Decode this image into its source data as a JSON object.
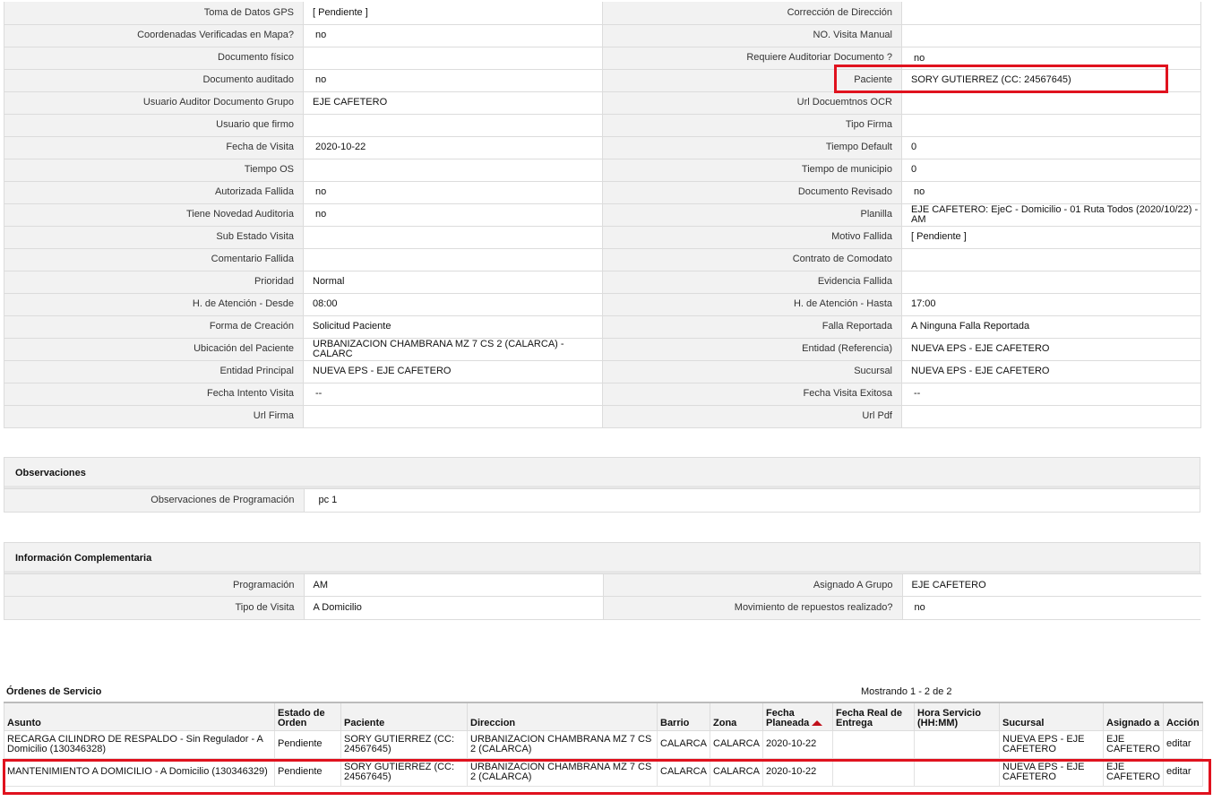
{
  "detail": {
    "rows": [
      [
        {
          "label": "Toma de Datos GPS",
          "value": "[ Pendiente ]"
        },
        {
          "label": "Corrección de Dirección",
          "value": ""
        }
      ],
      [
        {
          "label": "Coordenadas Verificadas en Mapa?",
          "value": "no"
        },
        {
          "label": "NO. Visita Manual",
          "value": ""
        }
      ],
      [
        {
          "label": "Documento físico",
          "value": ""
        },
        {
          "label": "Requiere Auditoriar Documento ?",
          "value": "no"
        }
      ],
      [
        {
          "label": "Documento auditado",
          "value": "no"
        },
        {
          "label": "Paciente",
          "value": "SORY GUTIERREZ (CC: 24567645)"
        }
      ],
      [
        {
          "label": "Usuario Auditor Documento Grupo",
          "value": "EJE CAFETERO"
        },
        {
          "label": "Url Docuemtnos OCR",
          "value": ""
        }
      ],
      [
        {
          "label": "Usuario que firmo",
          "value": ""
        },
        {
          "label": "Tipo Firma",
          "value": ""
        }
      ],
      [
        {
          "label": "Fecha de Visita",
          "value": "2020-10-22"
        },
        {
          "label": "Tiempo Default",
          "value": "0"
        }
      ],
      [
        {
          "label": "Tiempo OS",
          "value": ""
        },
        {
          "label": "Tiempo de municipio",
          "value": "0"
        }
      ],
      [
        {
          "label": "Autorizada Fallida",
          "value": "no"
        },
        {
          "label": "Documento Revisado",
          "value": "no"
        }
      ],
      [
        {
          "label": "Tiene Novedad Auditoria",
          "value": "no"
        },
        {
          "label": "Planilla",
          "value": "EJE CAFETERO: EjeC - Domicilio - 01 Ruta Todos (2020/10/22) - AM"
        }
      ],
      [
        {
          "label": "Sub Estado Visita",
          "value": ""
        },
        {
          "label": "Motivo Fallida",
          "value": "[ Pendiente ]"
        }
      ],
      [
        {
          "label": "Comentario Fallida",
          "value": ""
        },
        {
          "label": "Contrato de Comodato",
          "value": ""
        }
      ],
      [
        {
          "label": "Prioridad",
          "value": "Normal"
        },
        {
          "label": "Evidencia Fallida",
          "value": ""
        }
      ],
      [
        {
          "label": "H. de Atención - Desde",
          "value": "08:00"
        },
        {
          "label": "H. de Atención - Hasta",
          "value": "17:00"
        }
      ],
      [
        {
          "label": "Forma de Creación",
          "value": "Solicitud Paciente"
        },
        {
          "label": "Falla Reportada",
          "value": "A Ninguna Falla Reportada"
        }
      ],
      [
        {
          "label": "Ubicación del Paciente",
          "value": "URBANIZACION CHAMBRANA MZ 7 CS 2 (CALARCA) - CALARC"
        },
        {
          "label": "Entidad (Referencia)",
          "value": "NUEVA EPS - EJE CAFETERO"
        }
      ],
      [
        {
          "label": "Entidad Principal",
          "value": "NUEVA EPS - EJE CAFETERO"
        },
        {
          "label": "Sucursal",
          "value": "NUEVA EPS - EJE CAFETERO"
        }
      ],
      [
        {
          "label": "Fecha Intento Visita",
          "value": "--"
        },
        {
          "label": "Fecha Visita Exitosa",
          "value": "--"
        }
      ],
      [
        {
          "label": "Url Firma",
          "value": ""
        },
        {
          "label": "Url Pdf",
          "value": ""
        }
      ]
    ]
  },
  "observaciones": {
    "title": "Observaciones",
    "label": "Observaciones de Programación",
    "value": "pc 1"
  },
  "info_complementaria": {
    "title": "Información Complementaria",
    "rows": [
      [
        {
          "label": "Programación",
          "value": "AM"
        },
        {
          "label": "Asignado A Grupo",
          "value": "EJE CAFETERO"
        }
      ],
      [
        {
          "label": "Tipo de Visita",
          "value": "A Domicilio"
        },
        {
          "label": "Movimiento de repuestos realizado?",
          "value": "no"
        }
      ]
    ]
  },
  "ordenes": {
    "title": "Órdenes de Servicio",
    "count_text": "Mostrando 1 - 2 de 2",
    "columns": [
      "Asunto",
      "Estado de Orden",
      "Paciente",
      "Direccion",
      "Barrio",
      "Zona",
      "Fecha Planeada",
      "Fecha Real de Entrega",
      "Hora Servicio (HH:MM)",
      "Sucursal",
      "Asignado a",
      "Acción"
    ],
    "rows": [
      {
        "asunto": "RECARGA CILINDRO DE RESPALDO - Sin Regulador - A Domicilio (130346328)",
        "estado": "Pendiente",
        "paciente": "SORY GUTIERREZ (CC: 24567645)",
        "direccion": "URBANIZACION CHAMBRANA MZ 7 CS 2 (CALARCA)",
        "barrio": "CALARCA",
        "zona": "CALARCA",
        "fecha_planeada": "2020-10-22",
        "fecha_real": "",
        "hora": "",
        "sucursal": "NUEVA EPS - EJE CAFETERO",
        "asignado": "EJE CAFETERO",
        "accion": "editar"
      },
      {
        "asunto": "MANTENIMIENTO A DOMICILIO - A Domicilio (130346329)",
        "estado": "Pendiente",
        "paciente": "SORY GUTIERREZ (CC: 24567645)",
        "direccion": "URBANIZACION CHAMBRANA MZ 7 CS 2 (CALARCA)",
        "barrio": "CALARCA",
        "zona": "CALARCA",
        "fecha_planeada": "2020-10-22",
        "fecha_real": "",
        "hora": "",
        "sucursal": "NUEVA EPS - EJE CAFETERO",
        "asignado": "EJE CAFETERO",
        "accion": "editar"
      }
    ]
  },
  "colors": {
    "highlight": "#e0121e",
    "label_bg": "#f2f2f2",
    "sort_arrow": "#c0101a"
  }
}
